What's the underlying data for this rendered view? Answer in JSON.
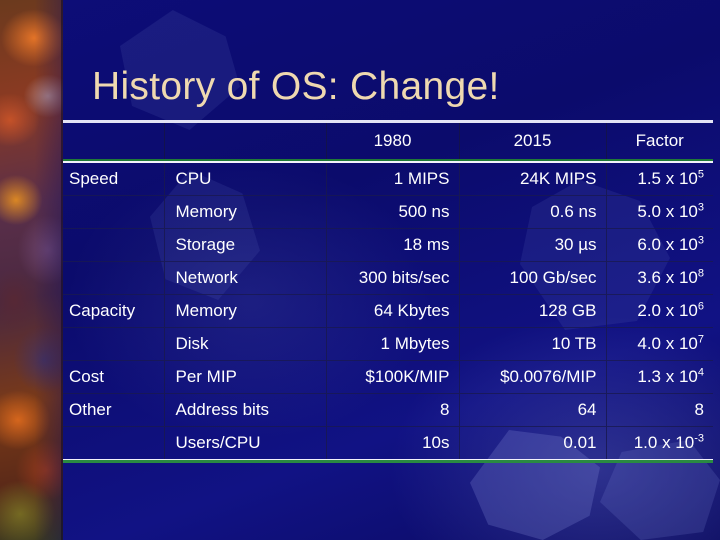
{
  "slide": {
    "title": "History of OS:  Change!",
    "title_color": "#efd9b0",
    "background_color": "#0b0b6c",
    "accent_rule_color": "#2a8a42"
  },
  "table": {
    "headers": [
      "",
      "",
      "1980",
      "2015",
      "Factor"
    ],
    "rows": [
      {
        "category": "Speed",
        "item": "CPU",
        "y1980": "1 MIPS",
        "y2015": "24K MIPS",
        "factor_base": "1.5 x 10",
        "factor_exp": "5"
      },
      {
        "category": "",
        "item": "Memory",
        "y1980": "500 ns",
        "y2015": "0.6 ns",
        "factor_base": "5.0 x 10",
        "factor_exp": "3"
      },
      {
        "category": "",
        "item": "Storage",
        "y1980": "18 ms",
        "y2015": "30 µs",
        "factor_base": "6.0 x 10",
        "factor_exp": "3"
      },
      {
        "category": "",
        "item": "Network",
        "y1980": "300 bits/sec",
        "y2015": "100 Gb/sec",
        "factor_base": "3.6 x 10",
        "factor_exp": "8"
      },
      {
        "category": "Capacity",
        "item": "Memory",
        "y1980": "64 Kbytes",
        "y2015": "128 GB",
        "factor_base": "2.0 x 10",
        "factor_exp": "6"
      },
      {
        "category": "",
        "item": "Disk",
        "y1980": "1 Mbytes",
        "y2015": "10 TB",
        "factor_base": "4.0 x 10",
        "factor_exp": "7"
      },
      {
        "category": "Cost",
        "item": "Per MIP",
        "y1980": "$100K/MIP",
        "y2015": "$0.0076/MIP",
        "factor_base": "1.3 x 10",
        "factor_exp": "4"
      },
      {
        "category": "Other",
        "item": "Address bits",
        "y1980": "8",
        "y2015": "64",
        "factor_base": "8",
        "factor_exp": ""
      },
      {
        "category": "",
        "item": "Users/CPU",
        "y1980": "10s",
        "y2015": "0.01",
        "factor_base": "1.0 x 10",
        "factor_exp": "-3"
      }
    ]
  }
}
